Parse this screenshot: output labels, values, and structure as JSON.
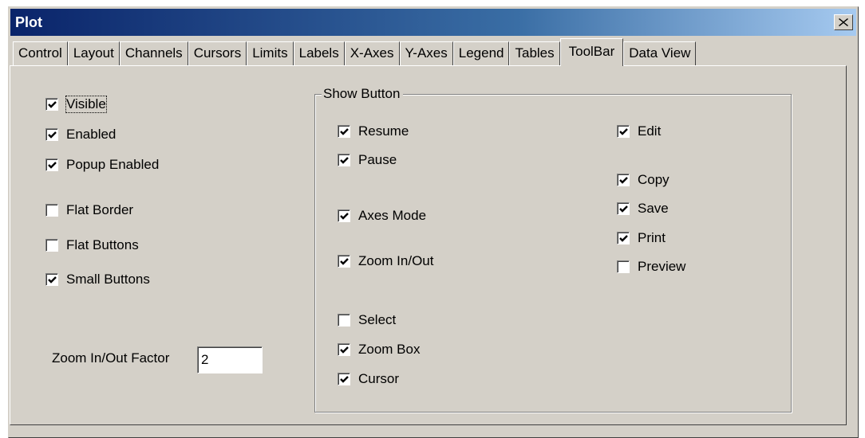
{
  "window": {
    "title": "Plot"
  },
  "tabs": [
    "Control",
    "Layout",
    "Channels",
    "Cursors",
    "Limits",
    "Labels",
    "X-Axes",
    "Y-Axes",
    "Legend",
    "Tables",
    "ToolBar",
    "Data View"
  ],
  "active_tab": "ToolBar",
  "toolbar_options": {
    "visible": {
      "label": "Visible",
      "checked": true
    },
    "enabled": {
      "label": "Enabled",
      "checked": true
    },
    "popup_enabled": {
      "label": "Popup Enabled",
      "checked": true
    },
    "flat_border": {
      "label": "Flat Border",
      "checked": false
    },
    "flat_buttons": {
      "label": "Flat Buttons",
      "checked": false
    },
    "small_buttons": {
      "label": "Small Buttons",
      "checked": true
    }
  },
  "zoom_factor": {
    "label": "Zoom In/Out Factor",
    "value": "2"
  },
  "show_button": {
    "title": "Show Button",
    "resume": {
      "label": "Resume",
      "checked": true
    },
    "pause": {
      "label": "Pause",
      "checked": true
    },
    "axes_mode": {
      "label": "Axes Mode",
      "checked": true
    },
    "zoom_in_out": {
      "label": "Zoom In/Out",
      "checked": true
    },
    "select": {
      "label": "Select",
      "checked": false
    },
    "zoom_box": {
      "label": "Zoom Box",
      "checked": true
    },
    "cursor": {
      "label": "Cursor",
      "checked": true
    },
    "edit": {
      "label": "Edit",
      "checked": true
    },
    "copy": {
      "label": "Copy",
      "checked": true
    },
    "save": {
      "label": "Save",
      "checked": true
    },
    "print": {
      "label": "Print",
      "checked": true
    },
    "preview": {
      "label": "Preview",
      "checked": false
    }
  }
}
